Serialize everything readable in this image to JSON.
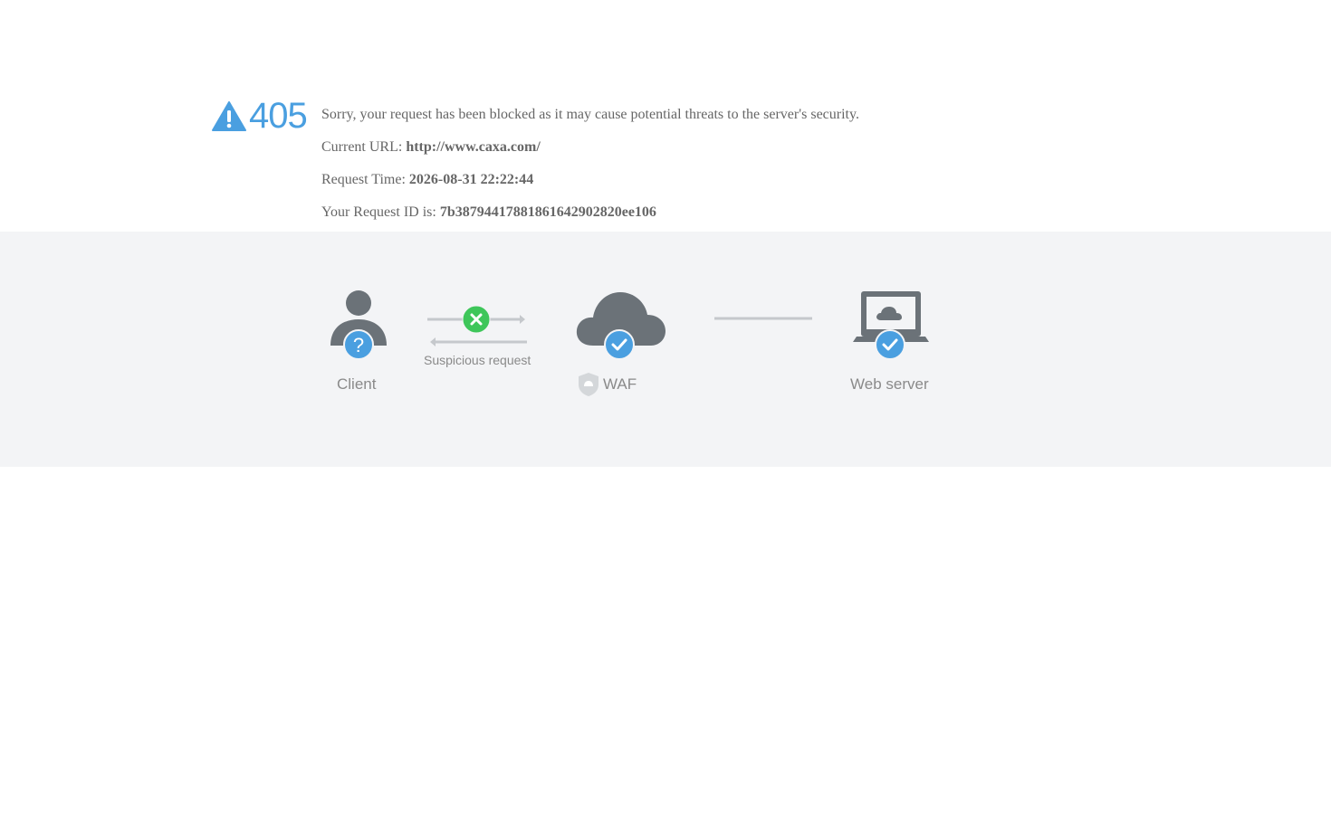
{
  "error": {
    "code": "405",
    "message": "Sorry, your request has been blocked as it may cause potential threats to the server's security."
  },
  "details": {
    "url_label": "Current URL: ",
    "url_value": "http://www.caxa.com/",
    "time_label": "Request Time: ",
    "time_value": "2026-08-31 22:22:44",
    "id_label": "Your Request ID is: ",
    "id_value": "7b38794417881861642902820ee106"
  },
  "diagram": {
    "client_label": "Client",
    "request_label": "Suspicious request",
    "waf_label": "WAF",
    "server_label": "Web server"
  },
  "colors": {
    "accent_blue": "#4a9fe0",
    "block_green": "#3ec65a",
    "icon_grey": "#6b7278",
    "band_bg": "#f3f4f6"
  },
  "icons": {
    "warning": "warning-triangle-icon",
    "client": "user-icon",
    "question": "question-icon",
    "block": "close-icon",
    "cloud": "cloud-icon",
    "check": "check-icon",
    "shield": "shield-icon",
    "laptop": "laptop-icon"
  }
}
